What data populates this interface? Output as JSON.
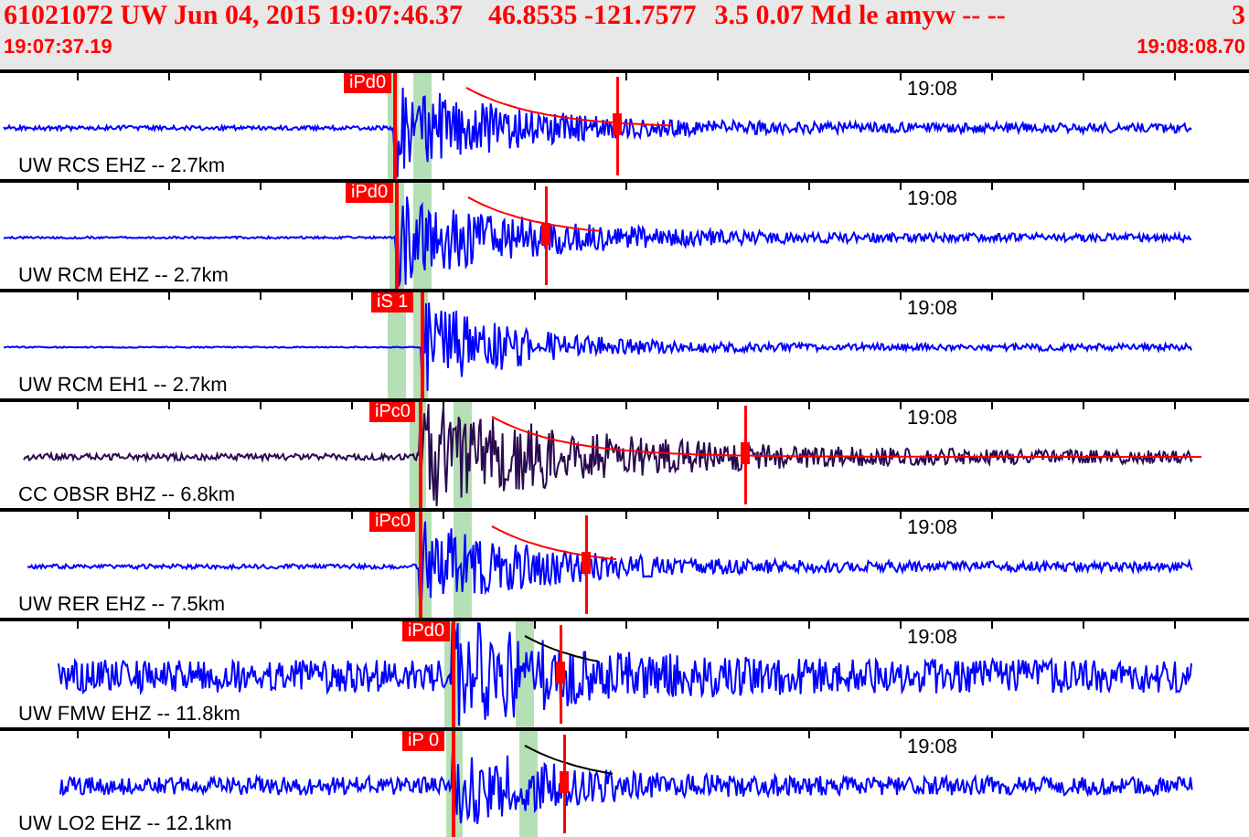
{
  "header": {
    "event": "61021072 UW Jun 04, 2015 19:07:46.37",
    "location": "46.8535 -121.7577",
    "magnitude": "3.5 0.07 Md le amyw -- --",
    "count": "3",
    "start_time": "19:07:37.19",
    "end_time": "19:08:08.70"
  },
  "traces": [
    {
      "station": "UW RCS EHZ -- 2.7km",
      "pick": "iPd0",
      "minute": "19:08",
      "color": "#0000ff"
    },
    {
      "station": "UW RCM EHZ -- 2.7km",
      "pick": "iPd0",
      "minute": "19:08",
      "color": "#0000ff"
    },
    {
      "station": "UW RCM EH1 -- 2.7km",
      "pick": "iS 1",
      "minute": "19:08",
      "color": "#0000ff"
    },
    {
      "station": "CC OBSR BHZ -- 6.8km",
      "pick": "iPc0",
      "minute": "19:08",
      "color": "#2a0a50"
    },
    {
      "station": "UW RER EHZ -- 7.5km",
      "pick": "iPc0",
      "minute": "19:08",
      "color": "#0000ff"
    },
    {
      "station": "UW FMW EHZ -- 11.8km",
      "pick": "iPd0",
      "minute": "19:08",
      "color": "#0000ff"
    },
    {
      "station": "UW LO2 EHZ -- 12.1km",
      "pick": "iP 0",
      "minute": "19:08",
      "color": "#0000ff"
    }
  ]
}
